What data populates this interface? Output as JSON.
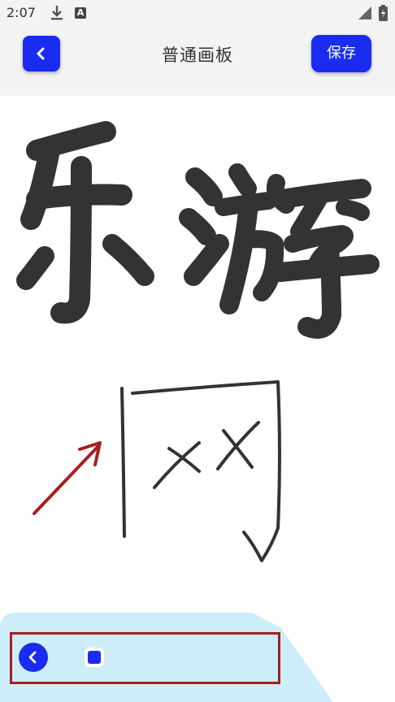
{
  "status_bar": {
    "time": "2:07",
    "icons": [
      "download-icon",
      "a-badge-icon",
      "signal-icon",
      "battery-icon"
    ],
    "a_badge": "A"
  },
  "header": {
    "title": "普通画板",
    "back_icon": "chevron-left-icon",
    "save_label": "保存"
  },
  "canvas": {
    "drawn_text": "乐游",
    "ink_color": "#333333",
    "annotation_arrow_color": "#a51f1f"
  },
  "toolbar": {
    "back_icon": "chevron-left-icon",
    "brush_size_fraction": 0.1
  },
  "colors": {
    "accent": "#1a2cf0",
    "header_bg": "#f3f3f3",
    "toolbar_bg": "#cdeef8",
    "highlight_frame": "#a51f1f"
  }
}
